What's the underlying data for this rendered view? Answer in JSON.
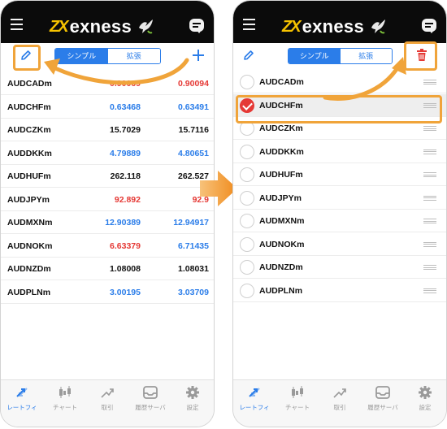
{
  "brand": {
    "logo_mark": "ZX",
    "logo_text": "exness"
  },
  "toolbar": {
    "tab_simple": "シンプル",
    "tab_extended": "拡張"
  },
  "left_rows": [
    {
      "symbol": "AUDCADm",
      "bid": "0.90069",
      "ask": "0.90094",
      "bid_color": "red",
      "ask_color": "red"
    },
    {
      "symbol": "AUDCHFm",
      "bid": "0.63468",
      "ask": "0.63491",
      "bid_color": "blue",
      "ask_color": "blue"
    },
    {
      "symbol": "AUDCZKm",
      "bid": "15.7029",
      "ask": "15.7116",
      "bid_color": "black",
      "ask_color": "black"
    },
    {
      "symbol": "AUDDKKm",
      "bid": "4.79889",
      "ask": "4.80651",
      "bid_color": "blue",
      "ask_color": "blue"
    },
    {
      "symbol": "AUDHUFm",
      "bid": "262.118",
      "ask": "262.527",
      "bid_color": "black",
      "ask_color": "black"
    },
    {
      "symbol": "AUDJPYm",
      "bid": "92.892",
      "ask": "92.9",
      "bid_color": "red",
      "ask_color": "red"
    },
    {
      "symbol": "AUDMXNm",
      "bid": "12.90389",
      "ask": "12.94917",
      "bid_color": "blue",
      "ask_color": "blue"
    },
    {
      "symbol": "AUDNOKm",
      "bid": "6.63379",
      "ask": "6.71435",
      "bid_color": "red",
      "ask_color": "blue"
    },
    {
      "symbol": "AUDNZDm",
      "bid": "1.08008",
      "ask": "1.08031",
      "bid_color": "black",
      "ask_color": "black"
    },
    {
      "symbol": "AUDPLNm",
      "bid": "3.00195",
      "ask": "3.03709",
      "bid_color": "blue",
      "ask_color": "blue"
    }
  ],
  "right_rows": [
    {
      "symbol": "AUDCADm",
      "selected": false
    },
    {
      "symbol": "AUDCHFm",
      "selected": true
    },
    {
      "symbol": "AUDCZKm",
      "selected": false
    },
    {
      "symbol": "AUDDKKm",
      "selected": false
    },
    {
      "symbol": "AUDHUFm",
      "selected": false
    },
    {
      "symbol": "AUDJPYm",
      "selected": false
    },
    {
      "symbol": "AUDMXNm",
      "selected": false
    },
    {
      "symbol": "AUDNOKm",
      "selected": false
    },
    {
      "symbol": "AUDNZDm",
      "selected": false
    },
    {
      "symbol": "AUDPLNm",
      "selected": false
    }
  ],
  "tabbar": {
    "quotes": "レートフィ",
    "chart": "チャート",
    "trade": "取引",
    "history": "履歴サーバ",
    "settings": "設定"
  },
  "colors": {
    "accent_blue": "#2b7de9",
    "price_red": "#e53935",
    "highlight_orange": "#f0a43a",
    "header_black": "#0b0b0b",
    "brand_yellow": "#f6c300"
  }
}
